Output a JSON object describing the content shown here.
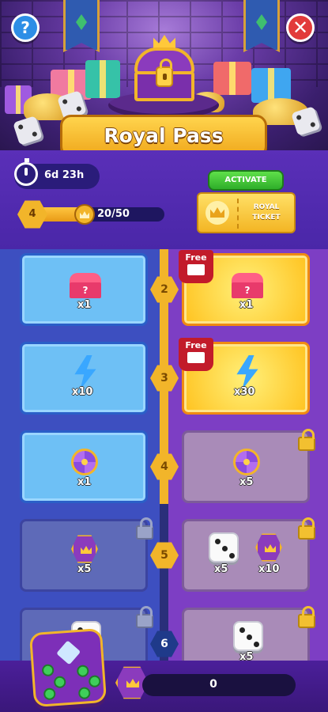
{
  "header": {
    "title": "Royal Pass",
    "help_label": "?",
    "close_label": "✕"
  },
  "info": {
    "timer": "6d 23h",
    "level": "4",
    "progress_text": "20/50",
    "progress_value": 0.4,
    "activate_label": "ACTIVATE",
    "ticket_label": "ROYAL TICKET"
  },
  "tiers": [
    {
      "level": "2",
      "free_qty": "x1",
      "premium_qty": "x1",
      "free_badge": "Free"
    },
    {
      "level": "3",
      "free_qty": "x10",
      "premium_qty": "x30",
      "free_badge": "Free"
    },
    {
      "level": "4",
      "free_qty": "x1",
      "premium_qty": "x5"
    },
    {
      "level": "5",
      "free_qty": "x5",
      "premium_qty_a": "x5",
      "premium_qty_b": "x10"
    },
    {
      "level": "6",
      "premium_qty": "x5"
    }
  ],
  "footer": {
    "count": "0"
  },
  "colors": {
    "gold": "#f2b52a",
    "free_track": "#3d4fc0",
    "premium_track": "#7d3ec4",
    "activate_green": "#2fae2a",
    "close_red": "#e23b3b",
    "help_blue": "#2d8ee6"
  }
}
